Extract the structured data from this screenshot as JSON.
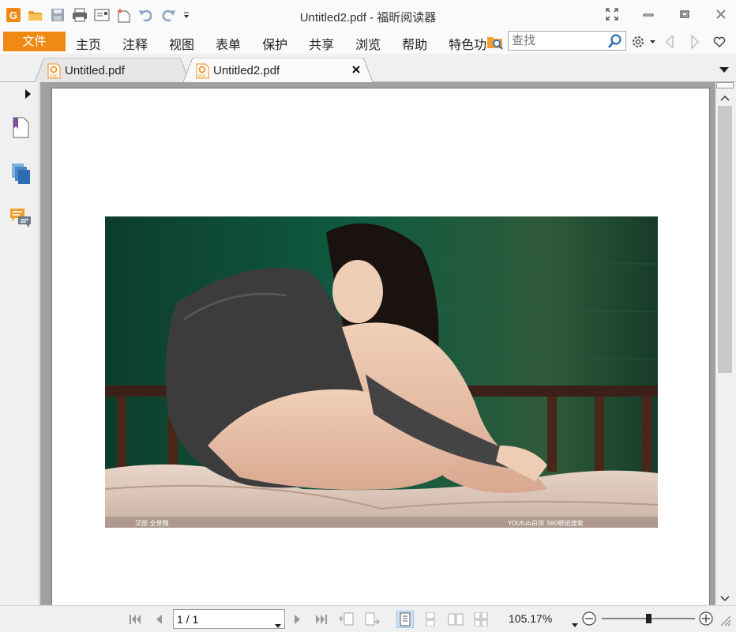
{
  "window": {
    "title": "Untitled2.pdf - 福昕阅读器"
  },
  "menu": {
    "file_label": "文件",
    "items": [
      "主页",
      "注释",
      "视图",
      "表单",
      "保护",
      "共享",
      "浏览",
      "帮助",
      "特色功"
    ]
  },
  "search": {
    "placeholder": "查找"
  },
  "tabs": [
    {
      "label": "Untitled.pdf",
      "active": false
    },
    {
      "label": "Untitled2.pdf",
      "active": true
    }
  ],
  "statusbar": {
    "page_value": "1 / 1",
    "zoom": "105.17%",
    "zoom_slider_fraction": 0.5
  },
  "document": {
    "photo_caption_left": "艾图  全景魏",
    "photo_caption_right": "YOUtub白领  360壁纸搜索"
  },
  "colors": {
    "accent": "#f08a14",
    "icon_blue": "#2e6db4",
    "icon_orange": "#f0a030"
  }
}
